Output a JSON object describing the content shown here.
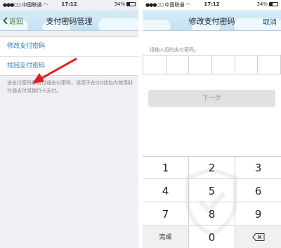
{
  "status_bar": {
    "carrier": "中国联通",
    "time": "17:12",
    "battery_text": "34%",
    "battery_level": 0.34
  },
  "left_screen": {
    "nav": {
      "back_label": "返回",
      "title": "支付密码管理"
    },
    "menu_items": [
      {
        "label": "修改支付密码"
      },
      {
        "label": "找回支付密码"
      }
    ],
    "note": "该支付密码即财付通支付密码，适用于在QQ钱包内使用财付通支付或银行卡支付。"
  },
  "right_screen": {
    "nav": {
      "title": "修改支付密码",
      "cancel_label": "取消"
    },
    "prompt": "请输入旧的支付密码。",
    "password_digits": 6,
    "next_button": "下一步",
    "keypad": {
      "rows": [
        [
          "1",
          "2",
          "3"
        ],
        [
          "4",
          "5",
          "6"
        ],
        [
          "7",
          "8",
          "9"
        ]
      ],
      "done_label": "完成",
      "zero_label": "0",
      "delete_icon": "backspace-icon"
    }
  },
  "colors": {
    "accent_link": "#2a7dc1",
    "annotation_arrow": "#e21b1b",
    "nav_bar": "#cfe6f6",
    "back_button": "#2f7a2f"
  }
}
